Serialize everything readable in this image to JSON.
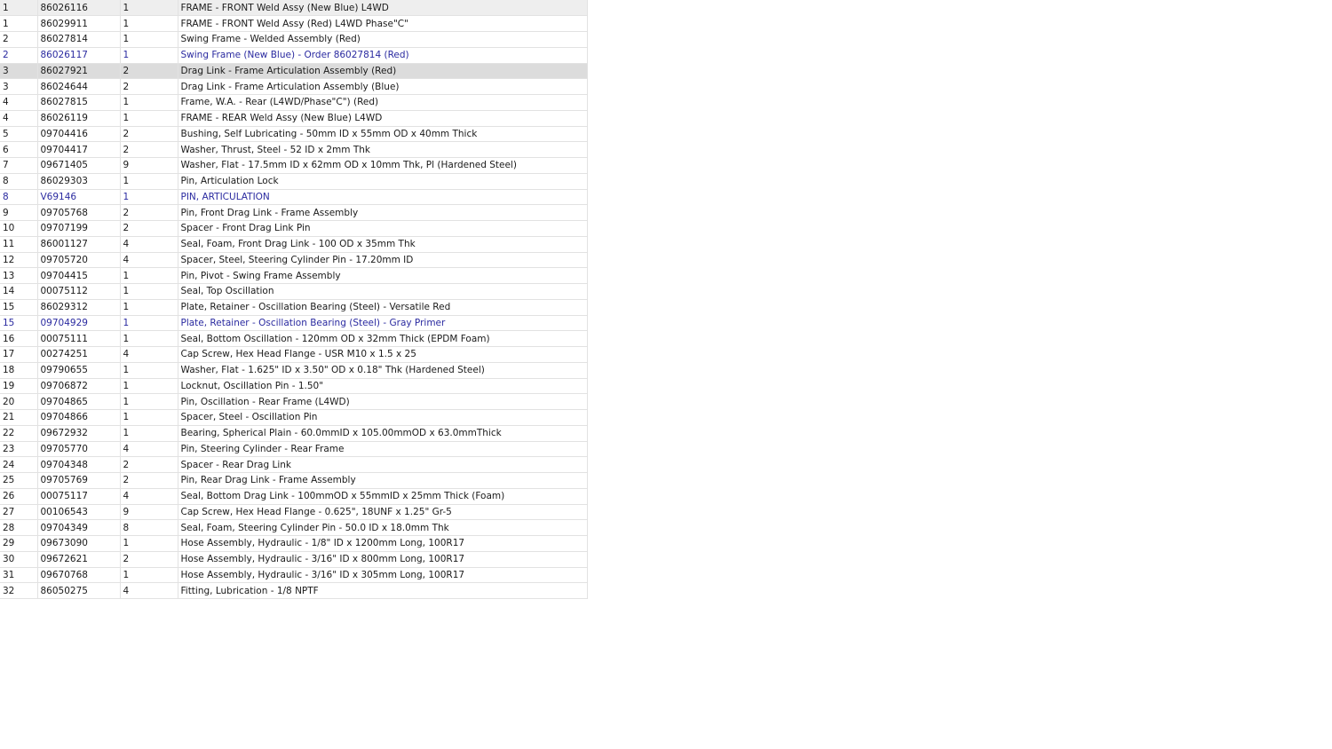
{
  "parts_table": {
    "rows": [
      {
        "ref": "1",
        "part_number": "86026116",
        "qty": "1",
        "description": "FRAME - FRONT Weld Assy (New Blue) L4WD",
        "alt": false,
        "selected": false
      },
      {
        "ref": "1",
        "part_number": "86029911",
        "qty": "1",
        "description": "FRAME - FRONT Weld Assy (Red) L4WD Phase\"C\"",
        "alt": false,
        "selected": false
      },
      {
        "ref": "2",
        "part_number": "86027814",
        "qty": "1",
        "description": "Swing Frame - Welded Assembly (Red)",
        "alt": false,
        "selected": false
      },
      {
        "ref": "2",
        "part_number": "86026117",
        "qty": "1",
        "description": "Swing Frame (New Blue) - Order 86027814 (Red)",
        "alt": true,
        "selected": false
      },
      {
        "ref": "3",
        "part_number": "86027921",
        "qty": "2",
        "description": "Drag Link - Frame Articulation Assembly (Red)",
        "alt": false,
        "selected": true
      },
      {
        "ref": "3",
        "part_number": "86024644",
        "qty": "2",
        "description": "Drag Link - Frame Articulation Assembly (Blue)",
        "alt": false,
        "selected": false
      },
      {
        "ref": "4",
        "part_number": "86027815",
        "qty": "1",
        "description": "Frame, W.A. - Rear (L4WD/Phase\"C\") (Red)",
        "alt": false,
        "selected": false
      },
      {
        "ref": "4",
        "part_number": "86026119",
        "qty": "1",
        "description": "FRAME - REAR Weld Assy (New Blue) L4WD",
        "alt": false,
        "selected": false
      },
      {
        "ref": "5",
        "part_number": "09704416",
        "qty": "2",
        "description": "Bushing, Self Lubricating - 50mm ID x 55mm OD x 40mm Thick",
        "alt": false,
        "selected": false
      },
      {
        "ref": "6",
        "part_number": "09704417",
        "qty": "2",
        "description": "Washer, Thrust, Steel - 52 ID x 2mm Thk",
        "alt": false,
        "selected": false
      },
      {
        "ref": "7",
        "part_number": "09671405",
        "qty": "9",
        "description": "Washer, Flat - 17.5mm ID x 62mm OD x 10mm Thk, Pl (Hardened Steel)",
        "alt": false,
        "selected": false
      },
      {
        "ref": "8",
        "part_number": "86029303",
        "qty": "1",
        "description": "Pin, Articulation Lock",
        "alt": false,
        "selected": false
      },
      {
        "ref": "8",
        "part_number": "V69146",
        "qty": "1",
        "description": "PIN, ARTICULATION",
        "alt": true,
        "selected": false
      },
      {
        "ref": "9",
        "part_number": "09705768",
        "qty": "2",
        "description": "Pin, Front Drag Link - Frame Assembly",
        "alt": false,
        "selected": false
      },
      {
        "ref": "10",
        "part_number": "09707199",
        "qty": "2",
        "description": "Spacer - Front Drag Link Pin",
        "alt": false,
        "selected": false
      },
      {
        "ref": "11",
        "part_number": "86001127",
        "qty": "4",
        "description": "Seal, Foam, Front Drag Link - 100 OD x 35mm Thk",
        "alt": false,
        "selected": false
      },
      {
        "ref": "12",
        "part_number": "09705720",
        "qty": "4",
        "description": "Spacer, Steel, Steering Cylinder Pin - 17.20mm ID",
        "alt": false,
        "selected": false
      },
      {
        "ref": "13",
        "part_number": "09704415",
        "qty": "1",
        "description": "Pin, Pivot - Swing Frame Assembly",
        "alt": false,
        "selected": false
      },
      {
        "ref": "14",
        "part_number": "00075112",
        "qty": "1",
        "description": "Seal, Top Oscillation",
        "alt": false,
        "selected": false
      },
      {
        "ref": "15",
        "part_number": "86029312",
        "qty": "1",
        "description": "Plate, Retainer - Oscillation Bearing (Steel) - Versatile Red",
        "alt": false,
        "selected": false
      },
      {
        "ref": "15",
        "part_number": "09704929",
        "qty": "1",
        "description": "Plate, Retainer - Oscillation Bearing (Steel) - Gray Primer",
        "alt": true,
        "selected": false
      },
      {
        "ref": "16",
        "part_number": "00075111",
        "qty": "1",
        "description": "Seal, Bottom Oscillation - 120mm OD x 32mm Thick (EPDM Foam)",
        "alt": false,
        "selected": false
      },
      {
        "ref": "17",
        "part_number": "00274251",
        "qty": "4",
        "description": "Cap Screw, Hex Head Flange - USR M10 x 1.5 x 25",
        "alt": false,
        "selected": false
      },
      {
        "ref": "18",
        "part_number": "09790655",
        "qty": "1",
        "description": "Washer, Flat - 1.625\" ID x 3.50\" OD x 0.18\" Thk (Hardened Steel)",
        "alt": false,
        "selected": false
      },
      {
        "ref": "19",
        "part_number": "09706872",
        "qty": "1",
        "description": "Locknut, Oscillation Pin - 1.50\"",
        "alt": false,
        "selected": false
      },
      {
        "ref": "20",
        "part_number": "09704865",
        "qty": "1",
        "description": "Pin, Oscillation - Rear Frame (L4WD)",
        "alt": false,
        "selected": false
      },
      {
        "ref": "21",
        "part_number": "09704866",
        "qty": "1",
        "description": "Spacer, Steel - Oscillation Pin",
        "alt": false,
        "selected": false
      },
      {
        "ref": "22",
        "part_number": "09672932",
        "qty": "1",
        "description": "Bearing, Spherical Plain - 60.0mmID x 105.00mmOD x 63.0mmThick",
        "alt": false,
        "selected": false
      },
      {
        "ref": "23",
        "part_number": "09705770",
        "qty": "4",
        "description": "Pin, Steering Cylinder - Rear Frame",
        "alt": false,
        "selected": false
      },
      {
        "ref": "24",
        "part_number": "09704348",
        "qty": "2",
        "description": "Spacer - Rear Drag Link",
        "alt": false,
        "selected": false
      },
      {
        "ref": "25",
        "part_number": "09705769",
        "qty": "2",
        "description": "Pin, Rear Drag Link - Frame Assembly",
        "alt": false,
        "selected": false
      },
      {
        "ref": "26",
        "part_number": "00075117",
        "qty": "4",
        "description": "Seal, Bottom Drag Link - 100mmOD x 55mmID x 25mm Thick (Foam)",
        "alt": false,
        "selected": false
      },
      {
        "ref": "27",
        "part_number": "00106543",
        "qty": "9",
        "description": "Cap Screw, Hex Head Flange - 0.625\", 18UNF x 1.25\" Gr-5",
        "alt": false,
        "selected": false
      },
      {
        "ref": "28",
        "part_number": "09704349",
        "qty": "8",
        "description": "Seal, Foam, Steering Cylinder Pin - 50.0 ID x 18.0mm Thk",
        "alt": false,
        "selected": false
      },
      {
        "ref": "29",
        "part_number": "09673090",
        "qty": "1",
        "description": "Hose Assembly, Hydraulic - 1/8\" ID x 1200mm Long, 100R17",
        "alt": false,
        "selected": false
      },
      {
        "ref": "30",
        "part_number": "09672621",
        "qty": "2",
        "description": "Hose Assembly, Hydraulic - 3/16\" ID x 800mm Long, 100R17",
        "alt": false,
        "selected": false
      },
      {
        "ref": "31",
        "part_number": "09670768",
        "qty": "1",
        "description": "Hose Assembly, Hydraulic - 3/16\" ID x 305mm Long, 100R17",
        "alt": false,
        "selected": false
      },
      {
        "ref": "32",
        "part_number": "86050275",
        "qty": "4",
        "description": "Fitting, Lubrication - 1/8 NPTF",
        "alt": false,
        "selected": false
      }
    ]
  }
}
